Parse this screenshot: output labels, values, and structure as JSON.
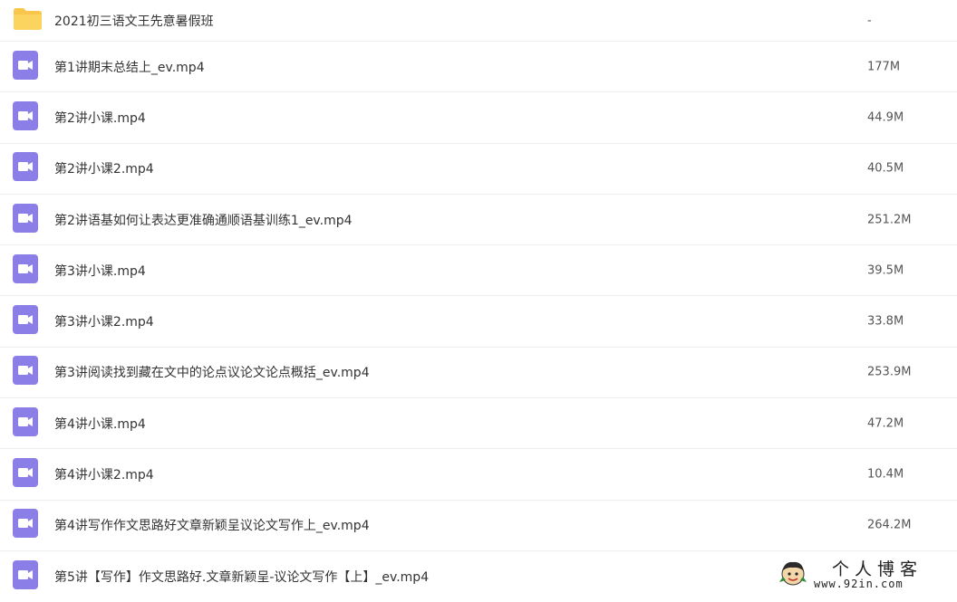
{
  "colors": {
    "folder": "#f9c64b",
    "video": "#8b7ee6",
    "divider": "#eeeeee"
  },
  "files": [
    {
      "icon": "folder-icon",
      "name": "2021初三语文王先意暑假班",
      "size": "-"
    },
    {
      "icon": "video-file-icon",
      "name": "第1讲期末总结上_ev.mp4",
      "size": "177M"
    },
    {
      "icon": "video-file-icon",
      "name": "第2讲小课.mp4",
      "size": "44.9M"
    },
    {
      "icon": "video-file-icon",
      "name": "第2讲小课2.mp4",
      "size": "40.5M"
    },
    {
      "icon": "video-file-icon",
      "name": "第2讲语基如何让表达更准确通顺语基训练1_ev.mp4",
      "size": "251.2M"
    },
    {
      "icon": "video-file-icon",
      "name": "第3讲小课.mp4",
      "size": "39.5M"
    },
    {
      "icon": "video-file-icon",
      "name": "第3讲小课2.mp4",
      "size": "33.8M"
    },
    {
      "icon": "video-file-icon",
      "name": "第3讲阅读找到藏在文中的论点议论文论点概括_ev.mp4",
      "size": "253.9M"
    },
    {
      "icon": "video-file-icon",
      "name": "第4讲小课.mp4",
      "size": "47.2M"
    },
    {
      "icon": "video-file-icon",
      "name": "第4讲小课2.mp4",
      "size": "10.4M"
    },
    {
      "icon": "video-file-icon",
      "name": "第4讲写作作文思路好文章新颖呈议论文写作上_ev.mp4",
      "size": "264.2M"
    },
    {
      "icon": "video-file-icon",
      "name": "第5讲【写作】作文思路好.文章新颖呈-议论文写作【上】_ev.mp4",
      "size": ""
    }
  ],
  "watermark": {
    "title": "个人博客",
    "url": "www.92in.com"
  }
}
